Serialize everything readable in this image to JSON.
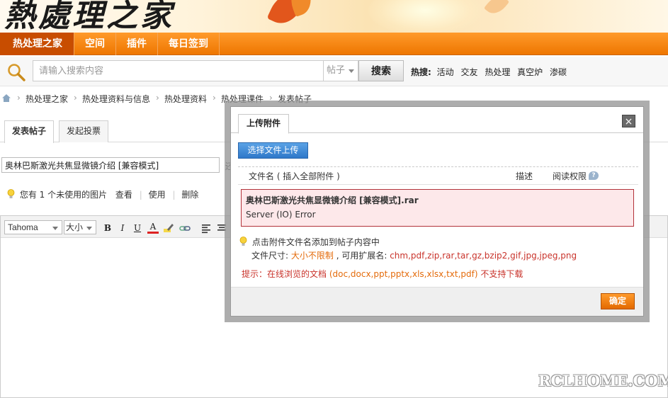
{
  "banner": {
    "logo_text": "熱處理之家"
  },
  "nav": {
    "items": [
      {
        "label": "热处理之家"
      },
      {
        "label": "空间"
      },
      {
        "label": "插件"
      },
      {
        "label": "每日签到"
      }
    ]
  },
  "search": {
    "placeholder": "请输入搜索内容",
    "type_value": "帖子",
    "button_label": "搜索",
    "hot_label": "热搜:",
    "hot_links": [
      "活动",
      "交友",
      "热处理",
      "真空炉",
      "渗碳"
    ]
  },
  "breadcrumb": [
    "热处理之家",
    "热处理资料与信息",
    "热处理资料",
    "热处理课件",
    "发表帖子"
  ],
  "post_tabs": [
    "发表帖子",
    "发起投票"
  ],
  "subject": {
    "value": "奥林巴斯激光共焦显微镜介绍 [兼容模式]",
    "overflow_text": "还"
  },
  "notice": {
    "text": "您有 1 个未使用的图片",
    "view": "查看",
    "use": "使用",
    "delete": "删除"
  },
  "editor": {
    "font": "Tahoma",
    "size": "大小",
    "bold": "B",
    "italic": "I",
    "underline": "U",
    "color": "A"
  },
  "dialog": {
    "tab_label": "上传附件",
    "close_label": "×",
    "upload_button": "选择文件上传",
    "col_filename": "文件名 ( 插入全部附件 )",
    "col_desc": "描述",
    "col_perm": "阅读权限",
    "error_filename": "奥林巴斯激光共焦显微镜介绍 [兼容模式].rar",
    "error_message": "Server (IO) Error",
    "tip_insert": "点击附件文件名添加到帖子内容中",
    "size_label": "文件尺寸: ",
    "size_value": "大小不限制",
    "ext_label": " , 可用扩展名: ",
    "ext_value": "chm,pdf,zip,rar,tar,gz,bzip2,gif,jpg,jpeg,png",
    "online_label": "提示：在线浏览的文档 ",
    "online_exts": "(doc,docx,ppt,pptx,xls,xlsx,txt,pdf)",
    "online_suffix": " 不支持下载",
    "ok_button": "确定"
  },
  "watermark": "RCLHOME.COM",
  "colors": {
    "nav_orange": "#ee7600",
    "nav_active": "#c84d00",
    "upload_blue": "#2f78c9",
    "error_red": "#b3323a"
  }
}
